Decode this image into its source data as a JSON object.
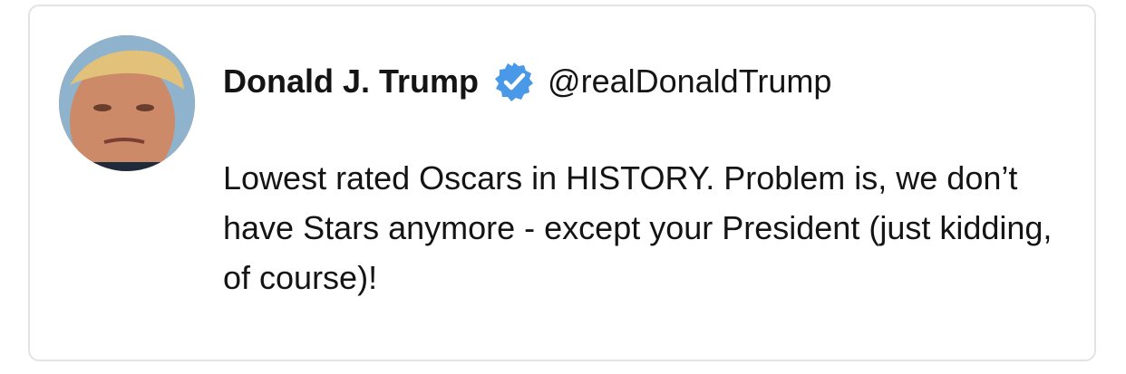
{
  "tweet": {
    "author_name": "Donald J. Trump",
    "verified_icon": "verified-badge-icon",
    "handle": "@realDonaldTrump",
    "text": "Lowest rated Oscars in HISTORY. Problem is, we don’t have Stars anymore - except your President (just kidding, of course)!"
  },
  "colors": {
    "verified_blue": "#4a99e9",
    "text": "#141414",
    "border": "#e3e3e3"
  }
}
